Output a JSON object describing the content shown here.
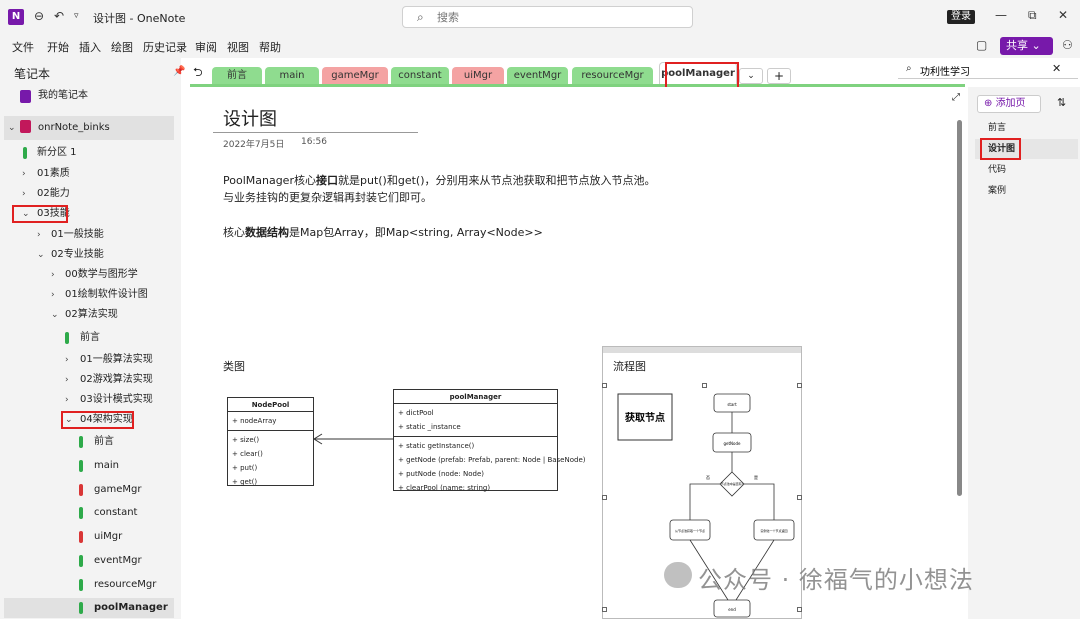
{
  "titlebar": {
    "title": "设计图 - OneNote",
    "search_placeholder": "搜索",
    "login": "登录"
  },
  "menu": [
    "文件",
    "开始",
    "插入",
    "绘图",
    "历史记录",
    "审阅",
    "视图",
    "帮助"
  ],
  "share_label": "共享",
  "sidebar": {
    "header": "笔记本",
    "items": [
      {
        "label": "我的笔记本",
        "kind": "notebook",
        "color": "#7719aa"
      },
      {
        "label": "onrNote_binks",
        "kind": "notebook",
        "color": "#c2185b"
      },
      {
        "label": "新分区 1",
        "kind": "section",
        "color": "#2eaa4a"
      },
      {
        "label": "01素质",
        "kind": "group"
      },
      {
        "label": "02能力",
        "kind": "group"
      },
      {
        "label": "03技能",
        "kind": "group-open"
      },
      {
        "label": "01一般技能",
        "kind": "group"
      },
      {
        "label": "02专业技能",
        "kind": "group-open"
      },
      {
        "label": "00数学与图形学",
        "kind": "group"
      },
      {
        "label": "01绘制软件设计图",
        "kind": "group"
      },
      {
        "label": "02算法实现",
        "kind": "group-open"
      },
      {
        "label": "前言",
        "kind": "section",
        "color": "#2eaa4a"
      },
      {
        "label": "01一般算法实现",
        "kind": "group"
      },
      {
        "label": "02游戏算法实现",
        "kind": "group"
      },
      {
        "label": "03设计模式实现",
        "kind": "group"
      },
      {
        "label": "04架构实现",
        "kind": "group-open"
      },
      {
        "label": "前言",
        "kind": "section",
        "color": "#2eaa4a"
      },
      {
        "label": "main",
        "kind": "section",
        "color": "#2eaa4a"
      },
      {
        "label": "gameMgr",
        "kind": "section",
        "color": "#d93636"
      },
      {
        "label": "constant",
        "kind": "section",
        "color": "#2eaa4a"
      },
      {
        "label": "uiMgr",
        "kind": "section",
        "color": "#d93636"
      },
      {
        "label": "eventMgr",
        "kind": "section",
        "color": "#2eaa4a"
      },
      {
        "label": "resourceMgr",
        "kind": "section",
        "color": "#2eaa4a"
      },
      {
        "label": "poolManager",
        "kind": "section",
        "color": "#2eaa4a"
      }
    ]
  },
  "tabs": [
    {
      "label": "前言",
      "color": "#8fdc8f"
    },
    {
      "label": "main",
      "color": "#8fdc8f"
    },
    {
      "label": "gameMgr",
      "color": "#f4a3a3"
    },
    {
      "label": "constant",
      "color": "#8fdc8f"
    },
    {
      "label": "uiMgr",
      "color": "#f4a3a3"
    },
    {
      "label": "eventMgr",
      "color": "#8fdc8f"
    },
    {
      "label": "resourceMgr",
      "color": "#8fdc8f"
    },
    {
      "label": "poolManager",
      "color": "#ffffff"
    }
  ],
  "page_search_value": "功利性学习",
  "page": {
    "title": "设计图",
    "date": "2022年7月5日",
    "time": "16:56",
    "para1_a": "PoolManager核心",
    "para1_b": "接口",
    "para1_c": "就是put()和get()，分别用来从节点池获取和把节点放入节点池。",
    "para2": "与业务挂钩的更复杂逻辑再封装它们即可。",
    "para3_a": "核心",
    "para3_b": "数据结构",
    "para3_c": "是Map包Array，即Map<string, Array<Node>>",
    "class_label": "类图",
    "flow_label": "流程图"
  },
  "uml": {
    "nodepool": {
      "name": "NodePool",
      "fields": [
        "+ nodeArray"
      ],
      "methods": [
        "+ size()",
        "+ clear()",
        "+ put()",
        "+ get()"
      ]
    },
    "poolmanager": {
      "name": "poolManager",
      "fields": [
        "+ dictPool",
        "+ static _instance"
      ],
      "methods": [
        "+ static getInstance()",
        "+ getNode (prefab: Prefab, parent: Node | BaseNode)",
        "+ putNode (node: Node)",
        "+ clearPool (name: string)"
      ]
    }
  },
  "flow": {
    "title": "获取节点",
    "start": "start",
    "getnode": "getNode",
    "decision": "节点池中是否有?",
    "no": "否",
    "yes": "是",
    "left_box": "从节点池获取一个节点",
    "right_box": "实例化一个节点返回",
    "end": "end"
  },
  "pages_panel": {
    "add_label": "添加页",
    "items": [
      "前言",
      "设计图",
      "代码",
      "案例"
    ]
  },
  "watermark": "公众号 · 徐福气的小想法"
}
